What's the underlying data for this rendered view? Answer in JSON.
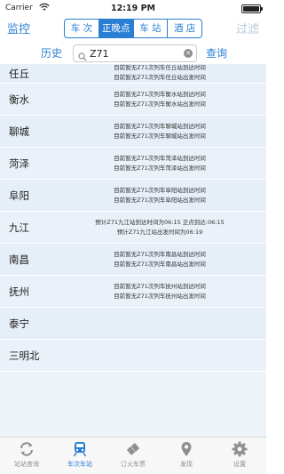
{
  "status_bar": {
    "carrier": "Carrier",
    "time": "12:19 PM"
  },
  "nav": {
    "left": "监控",
    "right": "过滤",
    "segments": [
      "车 次",
      "正晚点",
      "车 站",
      "酒 店"
    ],
    "active_segment": 1
  },
  "search": {
    "history": "历史",
    "value": "Z71",
    "query": "查询"
  },
  "stations": [
    {
      "name": "任丘",
      "lines": [
        "目前暂无Z71次列车任丘站到达时间",
        "目前暂无Z71次列车任丘站出发时间"
      ]
    },
    {
      "name": "衡水",
      "lines": [
        "目前暂无Z71次列车衡水站到达时间",
        "目前暂无Z71次列车衡水站出发时间"
      ]
    },
    {
      "name": "聊城",
      "lines": [
        "目前暂无Z71次列车聊城站到达时间",
        "目前暂无Z71次列车聊城站出发时间"
      ]
    },
    {
      "name": "菏泽",
      "lines": [
        "目前暂无Z71次列车菏泽站到达时间",
        "目前暂无Z71次列车菏泽站出发时间"
      ]
    },
    {
      "name": "阜阳",
      "lines": [
        "目前暂无Z71次列车阜阳站到达时间",
        "目前暂无Z71次列车阜阳站出发时间"
      ]
    },
    {
      "name": "九江",
      "lines": [
        "预计Z71九江站到达时间为06:15 正点到达:06:15",
        "预计Z71九江站出发时间为06:19"
      ]
    },
    {
      "name": "南昌",
      "lines": [
        "目前暂无Z71次列车南昌站到达时间",
        "目前暂无Z71次列车南昌站出发时间"
      ]
    },
    {
      "name": "抚州",
      "lines": [
        "目前暂无Z71次列车抚州站到达时间",
        "目前暂无Z71次列车抚州站出发时间"
      ]
    },
    {
      "name": "泰宁",
      "lines": []
    },
    {
      "name": "三明北",
      "lines": []
    }
  ],
  "tabs": [
    {
      "label": "站站查询",
      "icon": "refresh-icon"
    },
    {
      "label": "车次车站",
      "icon": "train-icon"
    },
    {
      "label": "订火车票",
      "icon": "ticket-icon"
    },
    {
      "label": "发现",
      "icon": "location-pin-icon"
    },
    {
      "label": "设置",
      "icon": "gear-icon"
    }
  ],
  "active_tab": 1,
  "colors": {
    "accent": "#2a7fd4",
    "inactive": "#8e8e93",
    "list_bg": "#e6eef7"
  }
}
